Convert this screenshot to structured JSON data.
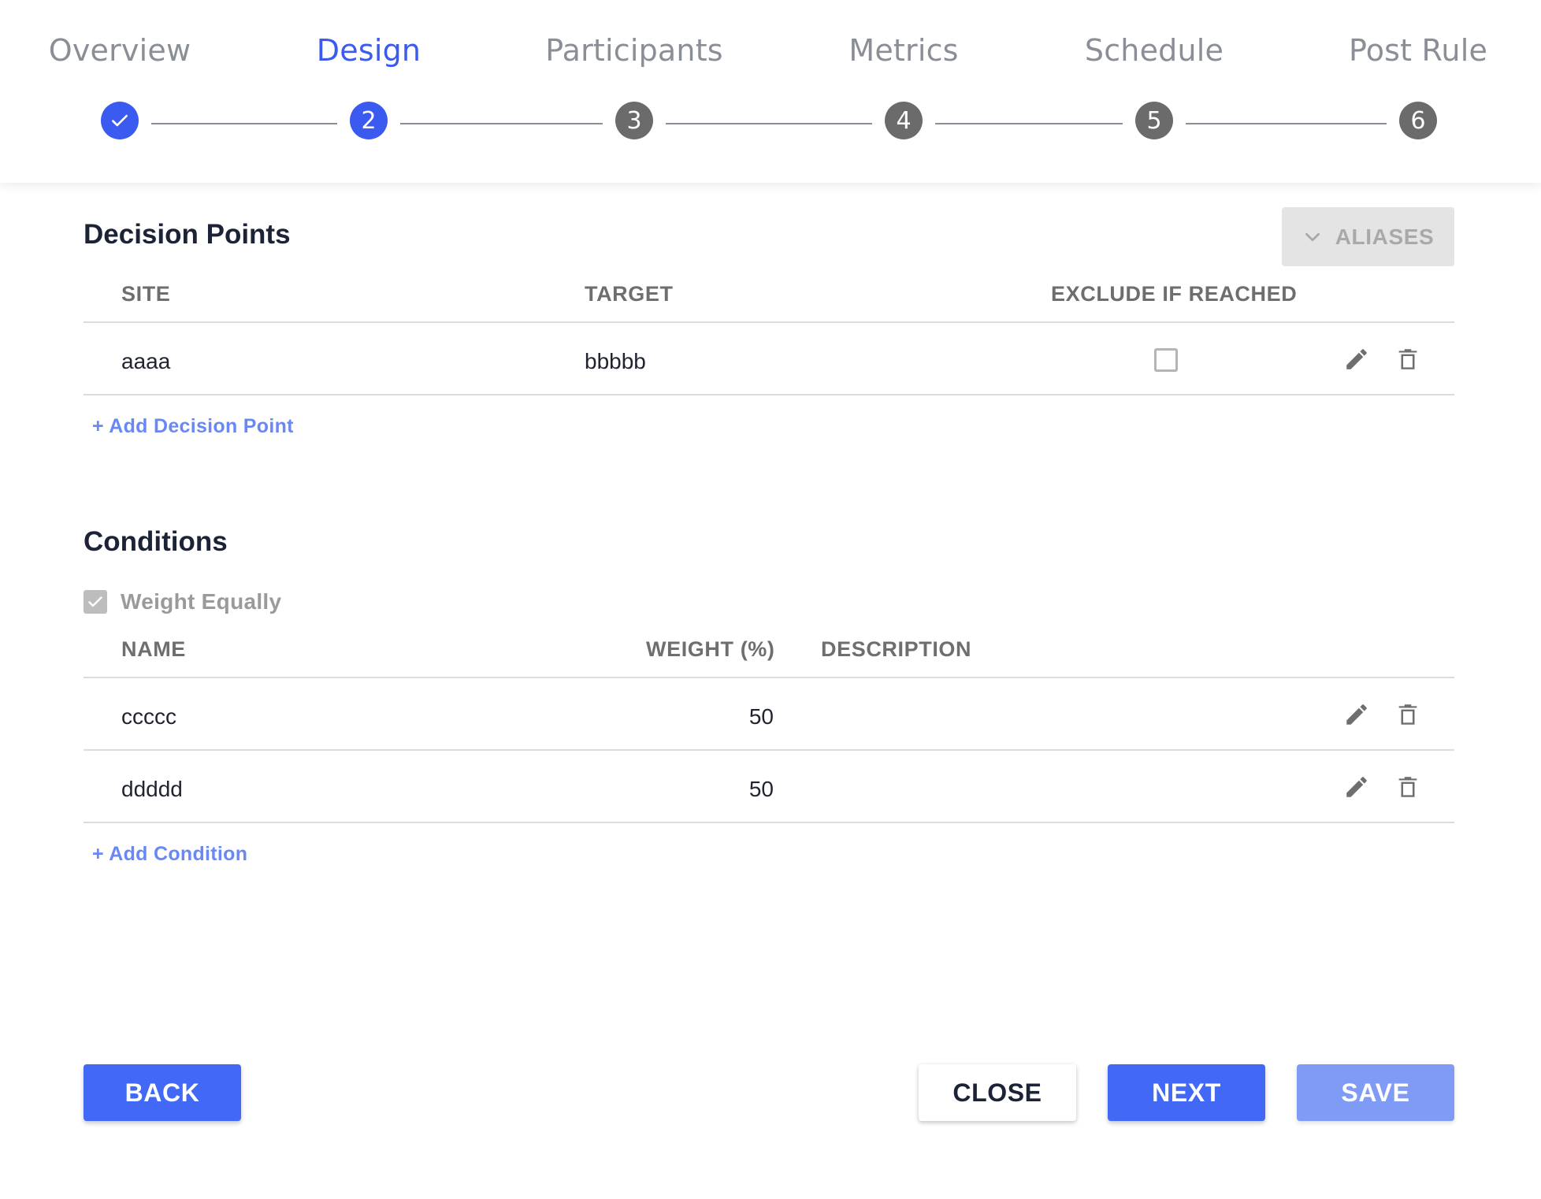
{
  "stepper": {
    "steps": [
      {
        "label": "Overview",
        "number": "",
        "state": "done"
      },
      {
        "label": "Design",
        "number": "2",
        "state": "active"
      },
      {
        "label": "Participants",
        "number": "3",
        "state": "upcoming"
      },
      {
        "label": "Metrics",
        "number": "4",
        "state": "upcoming"
      },
      {
        "label": "Schedule",
        "number": "5",
        "state": "upcoming"
      },
      {
        "label": "Post Rule",
        "number": "6",
        "state": "upcoming"
      }
    ]
  },
  "decision_points": {
    "title": "Decision Points",
    "aliases_label": "ALIASES",
    "columns": {
      "site": "SITE",
      "target": "TARGET",
      "exclude": "EXCLUDE IF REACHED"
    },
    "rows": [
      {
        "site": "aaaa",
        "target": "bbbbb",
        "exclude_if_reached": false
      }
    ],
    "add_label": "+ Add Decision Point"
  },
  "conditions": {
    "title": "Conditions",
    "weight_equally_label": "Weight Equally",
    "weight_equally_checked": true,
    "columns": {
      "name": "NAME",
      "weight": "WEIGHT (%)",
      "description": "DESCRIPTION"
    },
    "rows": [
      {
        "name": "ccccc",
        "weight": "50",
        "description": ""
      },
      {
        "name": "ddddd",
        "weight": "50",
        "description": ""
      }
    ],
    "add_label": "+ Add Condition"
  },
  "footer": {
    "back_label": "BACK",
    "close_label": "CLOSE",
    "next_label": "NEXT",
    "save_label": "SAVE"
  },
  "colors": {
    "accent": "#3b5bf0",
    "primary_button": "#4169f5",
    "disabled_button": "#7f9bf6",
    "link": "#6a88f5",
    "inactive_step": "#6b6b6b"
  },
  "icons": {
    "done_step": "check-icon",
    "aliases": "chevron-down-icon",
    "row_edit": "pencil-icon",
    "row_delete": "trash-icon"
  }
}
